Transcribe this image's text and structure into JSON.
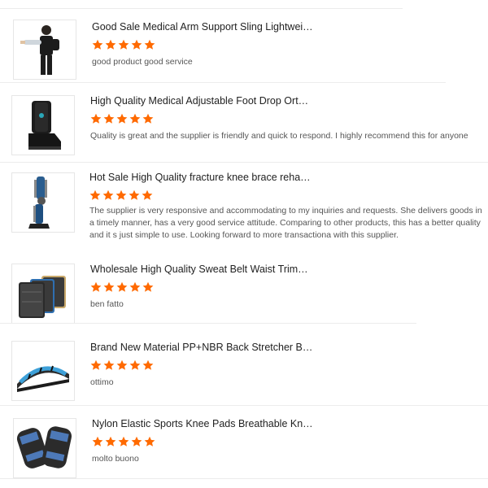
{
  "colors": {
    "star": "#ff6a00",
    "divider": "#ececec",
    "text": "#222222",
    "muted": "#555555"
  },
  "reviews": [
    {
      "title": "Good Sale Medical Arm Support Sling Lightwei…",
      "rating": 5,
      "comment": "good product good service",
      "image_icon": "arm-sling-icon"
    },
    {
      "title": "High Quality Medical Adjustable Foot Drop Ort…",
      "rating": 5,
      "comment": "Quality is great and the supplier is friendly and quick to respond. I highly recommend this for anyone",
      "image_icon": "walker-boot-icon"
    },
    {
      "title": "Hot Sale High Quality fracture knee brace reha…",
      "rating": 5,
      "comment": "The supplier is very responsive and accommodating to my inquiries and requests. She delivers goods in a timely manner, has a very good service attitude. Comparing to other products, this has a better quality and it s just simple to use. Looking forward to more transactiona with this supplier.",
      "image_icon": "knee-brace-icon"
    },
    {
      "title": "Wholesale High Quality Sweat Belt Waist Trim…",
      "rating": 5,
      "comment": "ben fatto",
      "image_icon": "waist-belt-icon"
    },
    {
      "title": "Brand New Material PP+NBR Back Stretcher B…",
      "rating": 5,
      "comment": "ottimo",
      "image_icon": "back-stretcher-icon"
    },
    {
      "title": "Nylon Elastic Sports Knee Pads Breathable Kn…",
      "rating": 5,
      "comment": "molto buono",
      "image_icon": "knee-pads-icon"
    }
  ]
}
